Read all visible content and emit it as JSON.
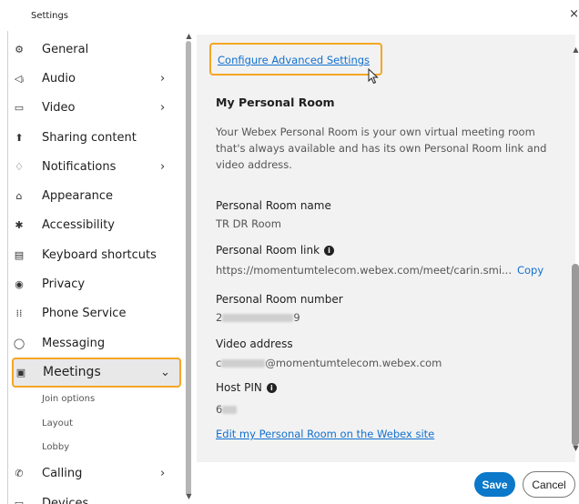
{
  "window": {
    "title": "Settings",
    "close_glyph": "×"
  },
  "sidebar": {
    "items": [
      {
        "label": "General",
        "icon": "⚙",
        "icon_name": "gear-icon",
        "chevron": ""
      },
      {
        "label": "Audio",
        "icon": "◁ᵢ",
        "icon_name": "speaker-icon",
        "chevron": "›"
      },
      {
        "label": "Video",
        "icon": "▭",
        "icon_name": "camera-icon",
        "chevron": "›"
      },
      {
        "label": "Sharing content",
        "icon": "⬆",
        "icon_name": "share-screen-icon",
        "chevron": ""
      },
      {
        "label": "Notifications",
        "icon": "♢",
        "icon_name": "bell-icon",
        "chevron": "›"
      },
      {
        "label": "Appearance",
        "icon": "⌂",
        "icon_name": "appearance-icon",
        "chevron": ""
      },
      {
        "label": "Accessibility",
        "icon": "✱",
        "icon_name": "accessibility-icon",
        "chevron": ""
      },
      {
        "label": "Keyboard shortcuts",
        "icon": "▤",
        "icon_name": "keyboard-icon",
        "chevron": ""
      },
      {
        "label": "Privacy",
        "icon": "◉",
        "icon_name": "privacy-icon",
        "chevron": ""
      },
      {
        "label": "Phone Service",
        "icon": "⁞⁞",
        "icon_name": "dialpad-icon",
        "chevron": ""
      },
      {
        "label": "Messaging",
        "icon": "◯",
        "icon_name": "chat-bubble-icon",
        "chevron": ""
      }
    ],
    "selected": {
      "label": "Meetings",
      "icon": "▣",
      "icon_name": "calendar-icon",
      "chevron": "⌄"
    },
    "sub_items": [
      "Join options",
      "Layout",
      "Lobby"
    ],
    "after_items": [
      {
        "label": "Calling",
        "icon": "✆",
        "icon_name": "phone-icon",
        "chevron": "›"
      },
      {
        "label": "Devices",
        "icon": "▭",
        "icon_name": "devices-icon",
        "chevron": ""
      }
    ]
  },
  "main": {
    "advanced_link": "Configure Advanced Settings",
    "section_title": "My Personal Room",
    "description": "Your Webex Personal Room is your own virtual meeting room that's always available and has its own Personal Room link and video address.",
    "fields": [
      {
        "label": "Personal Room name",
        "value": "TR DR Room"
      },
      {
        "label": "Personal Room link",
        "value": "https://momentumtelecom.webex.com/meet/carin.smi...",
        "action": "Copy",
        "info": "i"
      },
      {
        "label": "Personal Room number",
        "value_prefix": "2",
        "value_suffix": "9"
      },
      {
        "label": "Video address",
        "value_prefix": "c",
        "value_suffix": "@momentumtelecom.webex.com"
      },
      {
        "label": "Host PIN",
        "value_prefix": "6",
        "value_suffix": "",
        "info": "i"
      }
    ],
    "edit_link": "Edit my Personal Room on the Webex site"
  },
  "footer": {
    "save_label": "Save",
    "cancel_label": "Cancel"
  },
  "colors": {
    "accent": "#1170cf",
    "focus_outline": "#f5a623",
    "primary_button": "#0b78c9"
  }
}
